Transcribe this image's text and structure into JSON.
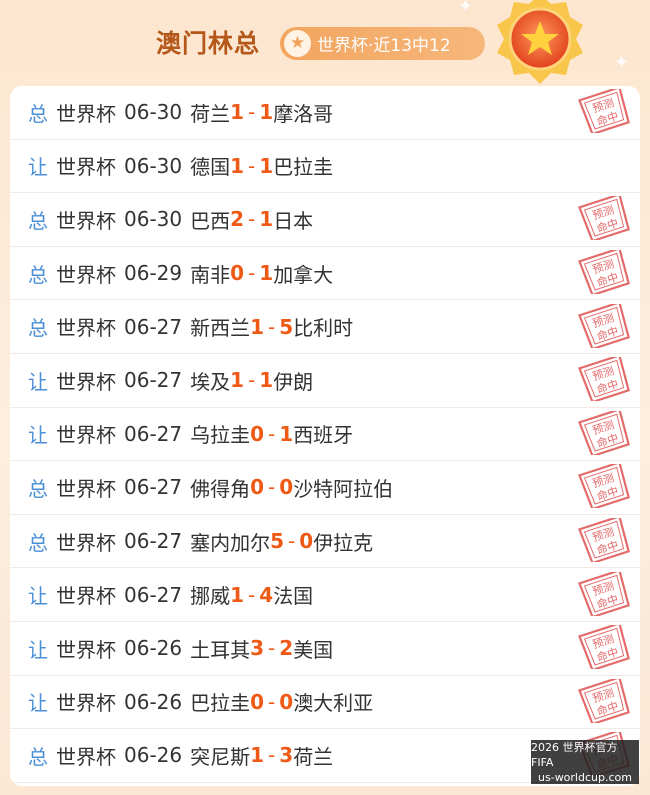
{
  "header": {
    "title": "澳门林总",
    "badge_text": "世界杯·近13中12"
  },
  "stamp_label": "预测命中",
  "rows": [
    {
      "type": "总",
      "league": "世界杯",
      "date": "06-30",
      "home": "荷兰",
      "home_score": "1",
      "away_score": "1",
      "away": "摩洛哥",
      "hit": true
    },
    {
      "type": "让",
      "league": "世界杯",
      "date": "06-30",
      "home": "德国",
      "home_score": "1",
      "away_score": "1",
      "away": "巴拉圭",
      "hit": false
    },
    {
      "type": "总",
      "league": "世界杯",
      "date": "06-30",
      "home": "巴西",
      "home_score": "2",
      "away_score": "1",
      "away": "日本",
      "hit": true
    },
    {
      "type": "总",
      "league": "世界杯",
      "date": "06-29",
      "home": "南非",
      "home_score": "0",
      "away_score": "1",
      "away": "加拿大",
      "hit": true
    },
    {
      "type": "总",
      "league": "世界杯",
      "date": "06-27",
      "home": "新西兰",
      "home_score": "1",
      "away_score": "5",
      "away": "比利时",
      "hit": true
    },
    {
      "type": "让",
      "league": "世界杯",
      "date": "06-27",
      "home": "埃及",
      "home_score": "1",
      "away_score": "1",
      "away": "伊朗",
      "hit": true
    },
    {
      "type": "让",
      "league": "世界杯",
      "date": "06-27",
      "home": "乌拉圭",
      "home_score": "0",
      "away_score": "1",
      "away": "西班牙",
      "hit": true
    },
    {
      "type": "总",
      "league": "世界杯",
      "date": "06-27",
      "home": "佛得角",
      "home_score": "0",
      "away_score": "0",
      "away": "沙特阿拉伯",
      "hit": true
    },
    {
      "type": "总",
      "league": "世界杯",
      "date": "06-27",
      "home": "塞内加尔",
      "home_score": "5",
      "away_score": "0",
      "away": "伊拉克",
      "hit": true
    },
    {
      "type": "让",
      "league": "世界杯",
      "date": "06-27",
      "home": "挪威",
      "home_score": "1",
      "away_score": "4",
      "away": "法国",
      "hit": true
    },
    {
      "type": "让",
      "league": "世界杯",
      "date": "06-26",
      "home": "土耳其",
      "home_score": "3",
      "away_score": "2",
      "away": "美国",
      "hit": true
    },
    {
      "type": "让",
      "league": "世界杯",
      "date": "06-26",
      "home": "巴拉圭",
      "home_score": "0",
      "away_score": "0",
      "away": "澳大利亚",
      "hit": true
    },
    {
      "type": "总",
      "league": "世界杯",
      "date": "06-26",
      "home": "突尼斯",
      "home_score": "1",
      "away_score": "3",
      "away": "荷兰",
      "hit": true
    }
  ],
  "watermark": {
    "line1": "2026 世界杯官方FIFA",
    "line2": "us-worldcup.com"
  }
}
